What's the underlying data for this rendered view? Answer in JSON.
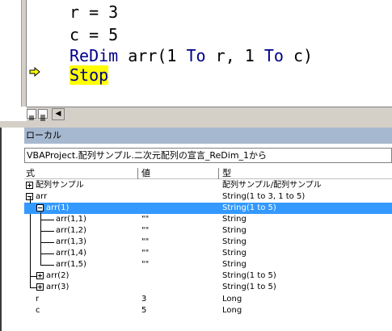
{
  "code": {
    "line1": "r = 3",
    "line2": "c = 5",
    "line3_kw1": "ReDim",
    "line3_mid": " arr(1 ",
    "line3_kw2": "To",
    "line3_mid2": " r, 1 ",
    "line3_kw3": "To",
    "line3_end": " c)",
    "line4": "Stop"
  },
  "locals": {
    "title": "ローカル",
    "context": "VBAProject.配列サンプル.二次元配列の宣言_ReDim_1から",
    "headers": {
      "expr": "式",
      "value": "値",
      "type": "型"
    },
    "rows": [
      {
        "expr": "配列サンプル",
        "value": "",
        "type": "配列サンプル/配列サンプル"
      },
      {
        "expr": "arr",
        "value": "",
        "type": "String(1 to 3, 1 to 5)"
      },
      {
        "expr": "arr(1)",
        "value": "",
        "type": "String(1 to 5)"
      },
      {
        "expr": "arr(1,1)",
        "value": "\"\"",
        "type": "String"
      },
      {
        "expr": "arr(1,2)",
        "value": "\"\"",
        "type": "String"
      },
      {
        "expr": "arr(1,3)",
        "value": "\"\"",
        "type": "String"
      },
      {
        "expr": "arr(1,4)",
        "value": "\"\"",
        "type": "String"
      },
      {
        "expr": "arr(1,5)",
        "value": "\"\"",
        "type": "String"
      },
      {
        "expr": "arr(2)",
        "value": "",
        "type": "String(1 to 5)"
      },
      {
        "expr": "arr(3)",
        "value": "",
        "type": "String(1 to 5)"
      },
      {
        "expr": "r",
        "value": "3",
        "type": "Long"
      },
      {
        "expr": "c",
        "value": "5",
        "type": "Long"
      }
    ]
  },
  "colors": {
    "selection": "#3399ff",
    "title_bar": "#a6b8cf",
    "keyword": "#00008b",
    "stop_highlight": "#ffff00"
  }
}
